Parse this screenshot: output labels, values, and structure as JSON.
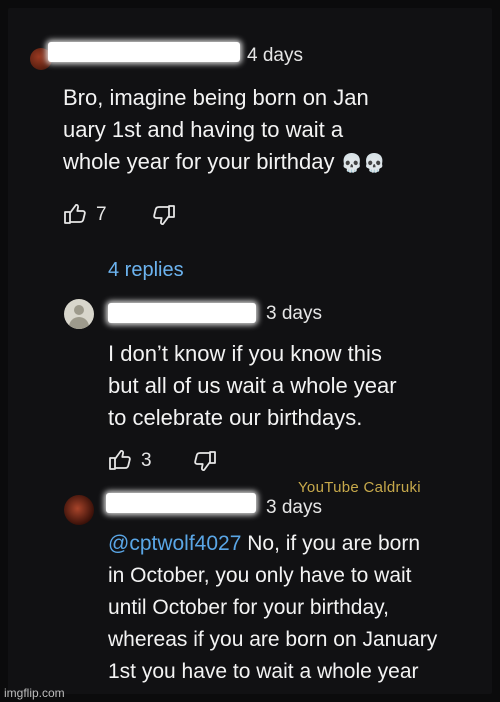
{
  "comments": [
    {
      "time": "4 days",
      "lines": [
        "Bro, imagine being born on Jan",
        "uary 1st and having to wait a",
        "whole year for your birthday"
      ],
      "emoji": "💀💀",
      "likes": "7"
    },
    {
      "time": "3 days",
      "lines": [
        "I don’t know if you know this",
        "but all of us wait a whole year",
        "to celebrate our birthdays."
      ],
      "likes": "3"
    },
    {
      "time": "3 days",
      "mention": "@cptwolf4027",
      "line1_rest": " No, if you are born",
      "lines": [
        "in October, you only have to wait",
        "until October for your birthday,",
        "whereas if you are born on January",
        "1st you have to wait a whole year"
      ]
    }
  ],
  "replies_label": "4 replies",
  "watermark": "YouTube Caldruki",
  "credit": "imgflip.com",
  "icons": {
    "like": "thumbs-up-icon",
    "dislike": "thumbs-down-icon"
  }
}
